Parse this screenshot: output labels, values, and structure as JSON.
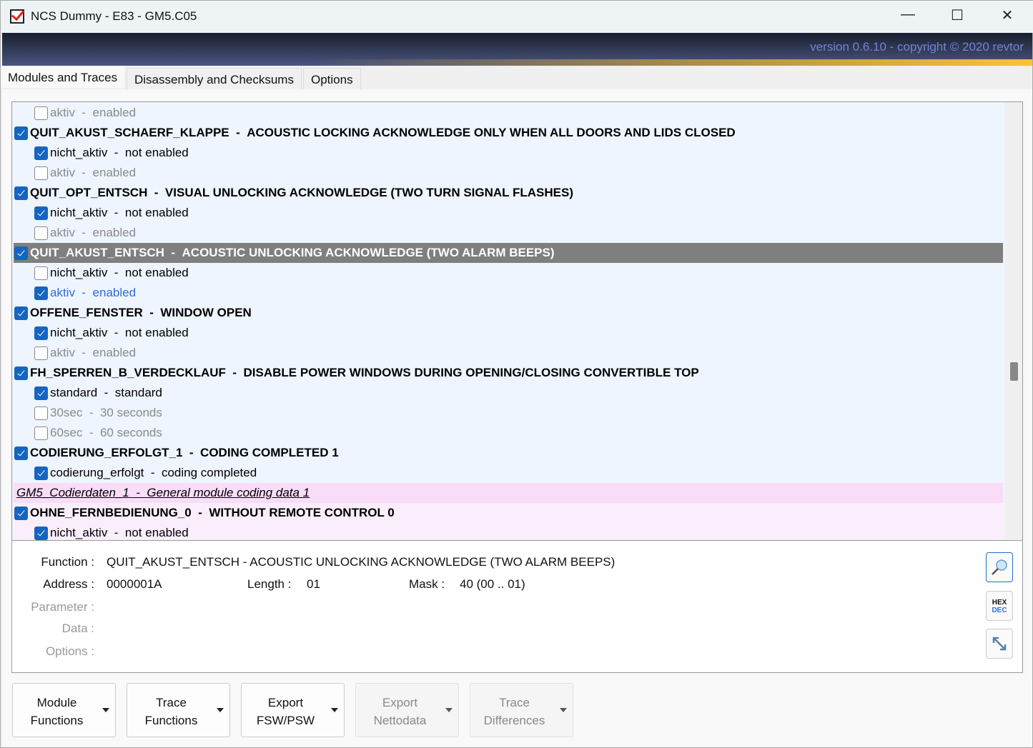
{
  "window": {
    "title": "NCS Dummy - E83 - GM5.C05",
    "version": "version 0.6.10 - copyright © 2020 revtor"
  },
  "tabs": [
    "Modules and Traces",
    "Disassembly and Checksums",
    "Options"
  ],
  "rows": [
    {
      "type": "op",
      "checked": false,
      "name": "aktiv",
      "desc": "enabled",
      "style": "dis"
    },
    {
      "type": "fn",
      "checked": true,
      "name": "QUIT_AKUST_SCHAERF_KLAPPE",
      "desc": "ACOUSTIC LOCKING ACKNOWLEDGE ONLY WHEN ALL DOORS AND LIDS CLOSED"
    },
    {
      "type": "op",
      "checked": true,
      "name": "nicht_aktiv",
      "desc": "not enabled"
    },
    {
      "type": "op",
      "checked": false,
      "name": "aktiv",
      "desc": "enabled",
      "style": "dis"
    },
    {
      "type": "fn",
      "checked": true,
      "name": "QUIT_OPT_ENTSCH",
      "desc": "VISUAL UNLOCKING ACKNOWLEDGE (TWO TURN SIGNAL FLASHES)"
    },
    {
      "type": "op",
      "checked": true,
      "name": "nicht_aktiv",
      "desc": "not enabled"
    },
    {
      "type": "op",
      "checked": false,
      "name": "aktiv",
      "desc": "enabled",
      "style": "dis"
    },
    {
      "type": "fn",
      "checked": true,
      "name": "QUIT_AKUST_ENTSCH",
      "desc": "ACOUSTIC UNLOCKING ACKNOWLEDGE (TWO ALARM BEEPS)",
      "style": "sel"
    },
    {
      "type": "op",
      "checked": false,
      "name": "nicht_aktiv",
      "desc": "not enabled"
    },
    {
      "type": "op",
      "checked": true,
      "name": "aktiv",
      "desc": "enabled",
      "style": "blue"
    },
    {
      "type": "fn",
      "checked": true,
      "name": "OFFENE_FENSTER",
      "desc": "WINDOW OPEN"
    },
    {
      "type": "op",
      "checked": true,
      "name": "nicht_aktiv",
      "desc": "not enabled"
    },
    {
      "type": "op",
      "checked": false,
      "name": "aktiv",
      "desc": "enabled",
      "style": "dis"
    },
    {
      "type": "fn",
      "checked": true,
      "name": "FH_SPERREN_B_VERDECKLAUF",
      "desc": "DISABLE POWER WINDOWS DURING OPENING/CLOSING CONVERTIBLE TOP"
    },
    {
      "type": "op",
      "checked": true,
      "name": "standard",
      "desc": "standard"
    },
    {
      "type": "op",
      "checked": false,
      "name": "30sec",
      "desc": "30 seconds",
      "style": "dis"
    },
    {
      "type": "op",
      "checked": false,
      "name": "60sec",
      "desc": "60 seconds",
      "style": "dis"
    },
    {
      "type": "fn",
      "checked": true,
      "name": "CODIERUNG_ERFOLGT_1",
      "desc": "CODING COMPLETED 1"
    },
    {
      "type": "op",
      "checked": true,
      "name": "codierung_erfolgt",
      "desc": "coding completed"
    },
    {
      "type": "group",
      "name": "GM5_Codierdaten_1",
      "desc": "General module coding data 1"
    },
    {
      "type": "fn",
      "checked": true,
      "name": "OHNE_FERNBEDIENUNG_0",
      "desc": "WITHOUT REMOTE CONTROL 0",
      "bg": "pink"
    },
    {
      "type": "op",
      "checked": true,
      "name": "nicht_aktiv",
      "desc": "not enabled",
      "bg": "pink"
    }
  ],
  "scroll_position_percent": 62,
  "details": {
    "function_label": "Function :",
    "function_value": "QUIT_AKUST_ENTSCH  -  ACOUSTIC UNLOCKING ACKNOWLEDGE (TWO ALARM BEEPS)",
    "address_label": "Address :",
    "address_value": "0000001A",
    "length_label": "Length :",
    "length_value": "01",
    "mask_label": "Mask :",
    "mask_value": "40  (00 .. 01)",
    "parameter_label": "Parameter :",
    "data_label": "Data :",
    "options_label": "Options :",
    "hex_label": "HEX",
    "dec_label": "DEC"
  },
  "buttons": [
    {
      "line1": "Module",
      "line2": "Functions",
      "enabled": true
    },
    {
      "line1": "Trace",
      "line2": "Functions",
      "enabled": true
    },
    {
      "line1": "Export",
      "line2": "FSW/PSW",
      "enabled": true
    },
    {
      "line1": "Export",
      "line2": "Nettodata",
      "enabled": false
    },
    {
      "line1": "Trace",
      "line2": "Differences",
      "enabled": false
    }
  ]
}
